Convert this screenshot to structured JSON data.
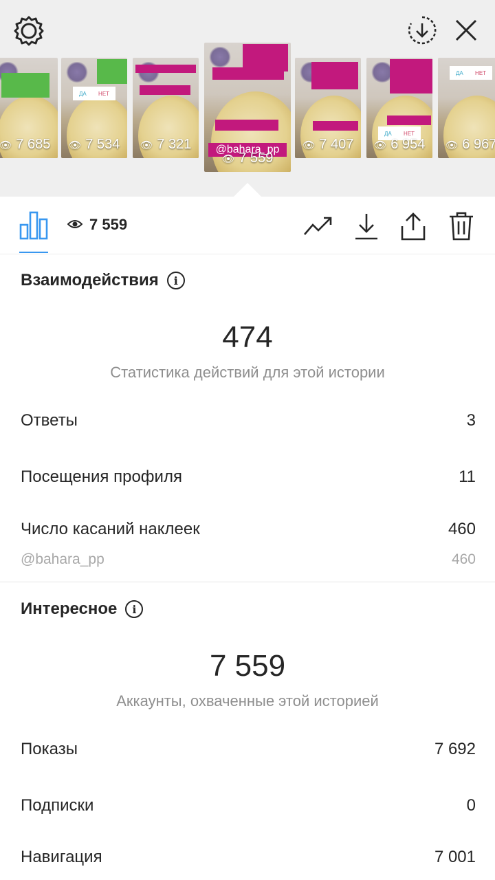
{
  "top_icons": [
    "gear-icon",
    "download-circle-icon",
    "close-icon"
  ],
  "thumbnails": [
    {
      "views": "7 685"
    },
    {
      "views": "7 534"
    },
    {
      "views": "7 321"
    },
    {
      "views": "7 559",
      "selected": true,
      "handle": "@bahara_pp"
    },
    {
      "views": "7 407"
    },
    {
      "views": "6 954"
    },
    {
      "views": "6 967"
    }
  ],
  "toolbar": {
    "views": "7 559",
    "icons": [
      "bar-chart-icon",
      "eye-icon",
      "trend-icon",
      "download-icon",
      "share-icon",
      "trash-icon"
    ]
  },
  "interactions": {
    "title": "Взаимодействия",
    "total": "474",
    "subtitle": "Статистика действий для этой истории",
    "rows": [
      {
        "label": "Ответы",
        "value": "3"
      },
      {
        "label": "Посещения профиля",
        "value": "11"
      },
      {
        "label": "Число касаний наклеек",
        "value": "460"
      }
    ],
    "sticker": {
      "label": "@bahara_pp",
      "value": "460"
    }
  },
  "discovery": {
    "title": "Интересное",
    "total": "7 559",
    "subtitle": "Аккаунты, охваченные этой историей",
    "rows": [
      {
        "label": "Показы",
        "value": "7 692"
      },
      {
        "label": "Подписки",
        "value": "0"
      },
      {
        "label": "Навигация",
        "value": "7 001"
      }
    ]
  },
  "colors": {
    "accent": "#3897f0",
    "sticker_pink": "#c2197d",
    "text": "#262626",
    "muted": "#8e8e8e"
  }
}
